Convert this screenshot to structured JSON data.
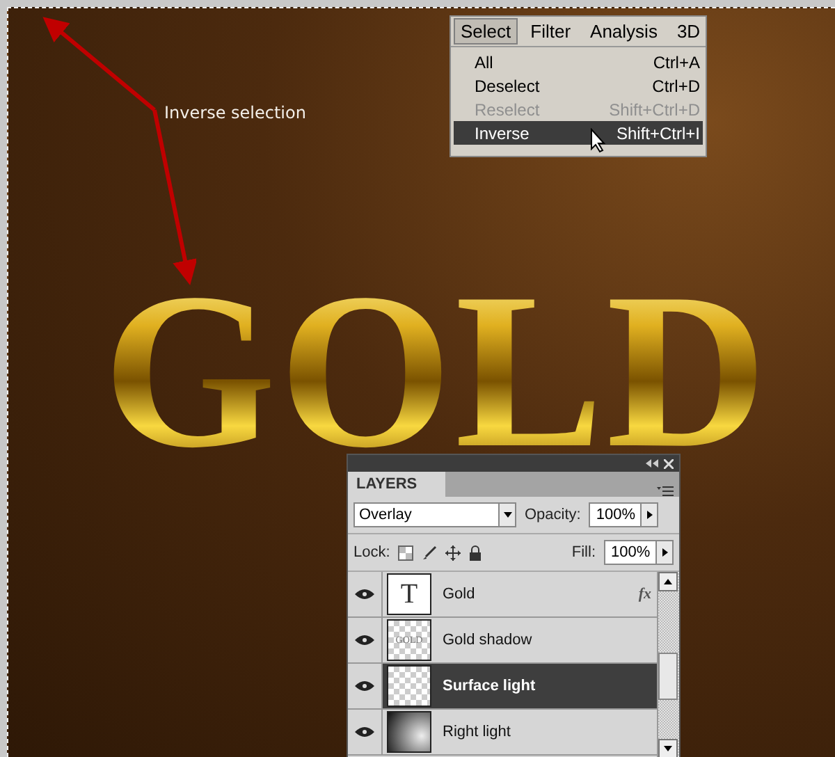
{
  "annotation": {
    "label": "Inverse selection"
  },
  "artwork": {
    "text": "GOLD"
  },
  "menu_bar": [
    {
      "label": "Select",
      "selected": true
    },
    {
      "label": "Filter",
      "selected": false
    },
    {
      "label": "Analysis",
      "selected": false
    },
    {
      "label": "3D",
      "selected": false
    }
  ],
  "menu": [
    {
      "label": "All",
      "shortcut": "Ctrl+A",
      "disabled": false,
      "selected": false
    },
    {
      "label": "Deselect",
      "shortcut": "Ctrl+D",
      "disabled": false,
      "selected": false
    },
    {
      "label": "Reselect",
      "shortcut": "Shift+Ctrl+D",
      "disabled": true,
      "selected": false
    },
    {
      "label": "Inverse",
      "shortcut": "Shift+Ctrl+I",
      "disabled": false,
      "selected": true
    }
  ],
  "layers_panel": {
    "tab": "LAYERS",
    "blend_mode": "Overlay",
    "opacity_label": "Opacity:",
    "opacity": "100%",
    "lock_label": "Lock:",
    "fill_label": "Fill:",
    "fill": "100%",
    "layers": [
      {
        "name": "Gold",
        "kind": "text",
        "thumb_text": "T",
        "fx": "fx",
        "selected": false,
        "visible": true
      },
      {
        "name": "Gold shadow",
        "kind": "raster",
        "thumb_text": "GOLD",
        "selected": false,
        "visible": true
      },
      {
        "name": "Surface light",
        "kind": "empty",
        "selected": true,
        "visible": true
      },
      {
        "name": "Right light",
        "kind": "gradient",
        "selected": false,
        "visible": true
      }
    ]
  }
}
